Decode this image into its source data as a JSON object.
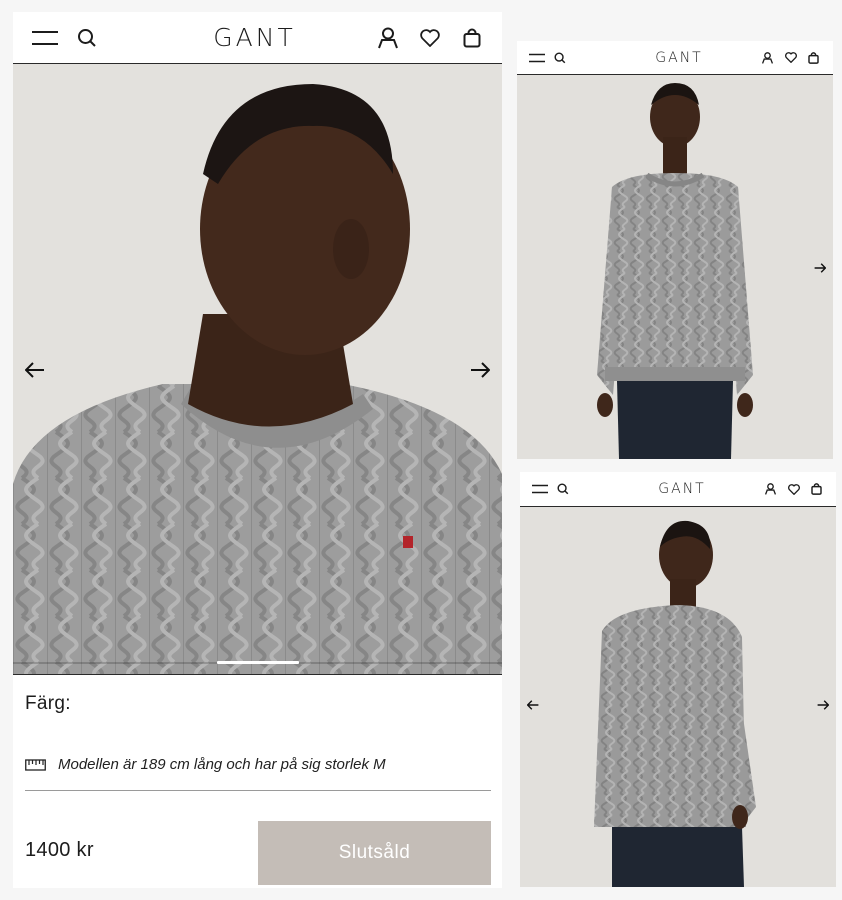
{
  "brand": {
    "logo_text": "GANT"
  },
  "colors": {
    "accent": "#1c1c1c",
    "soldout_bg": "#c4bdb7",
    "background": "#f6f6f6",
    "photo_bg": "#e3e1dd",
    "sweater": "#9b9b9b"
  },
  "header": {
    "icons": [
      "menu-icon",
      "search-icon",
      "account-icon",
      "wishlist-icon",
      "bag-icon"
    ]
  },
  "gallery": {
    "main_image": {
      "subject": "close-up-crop",
      "has_prev": true,
      "has_next": true
    },
    "progress": {
      "segments": 3,
      "active_index": 1
    }
  },
  "product": {
    "color_label": "Färg:",
    "model_info": "Modellen är 189 cm lång och har på sig storlek M",
    "price": "1400 kr",
    "cta_label": "Slutsåld"
  },
  "panels": [
    {
      "name": "front-view",
      "has_prev": false,
      "has_next": true
    },
    {
      "name": "back-view",
      "has_prev": true,
      "has_next": true
    }
  ]
}
